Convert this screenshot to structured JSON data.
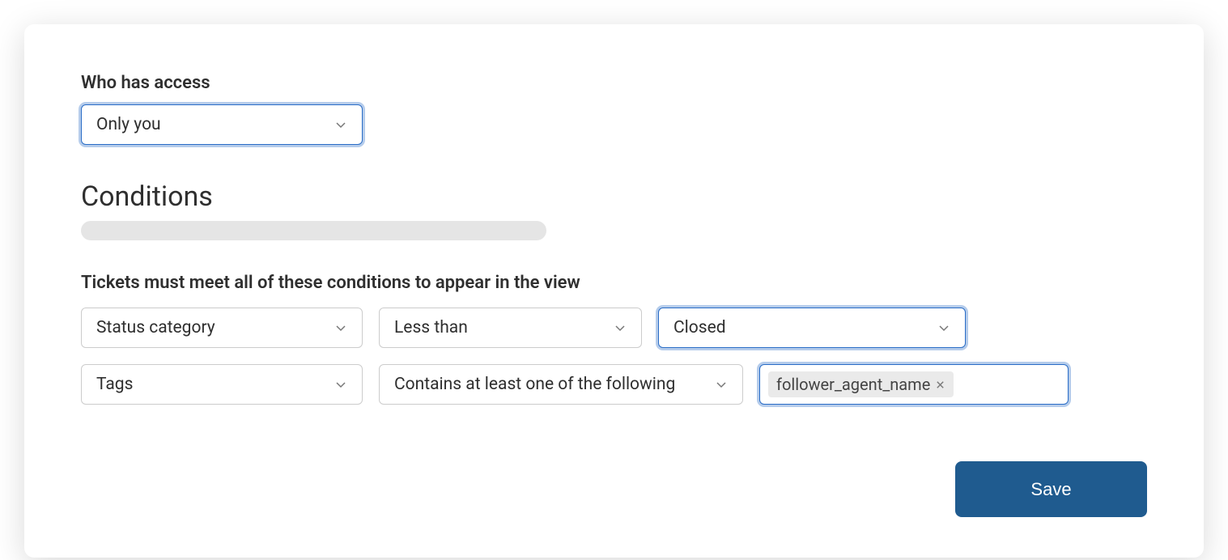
{
  "access": {
    "label": "Who has access",
    "value": "Only you"
  },
  "conditions": {
    "title": "Conditions",
    "subtext": "Tickets must meet all of these conditions to appear in the view",
    "rows": [
      {
        "field": "Status category",
        "operator": "Less than",
        "value": "Closed"
      },
      {
        "field": "Tags",
        "operator": "Contains at least one of the following",
        "tag": "follower_agent_name"
      }
    ]
  },
  "footer": {
    "save_label": "Save"
  }
}
